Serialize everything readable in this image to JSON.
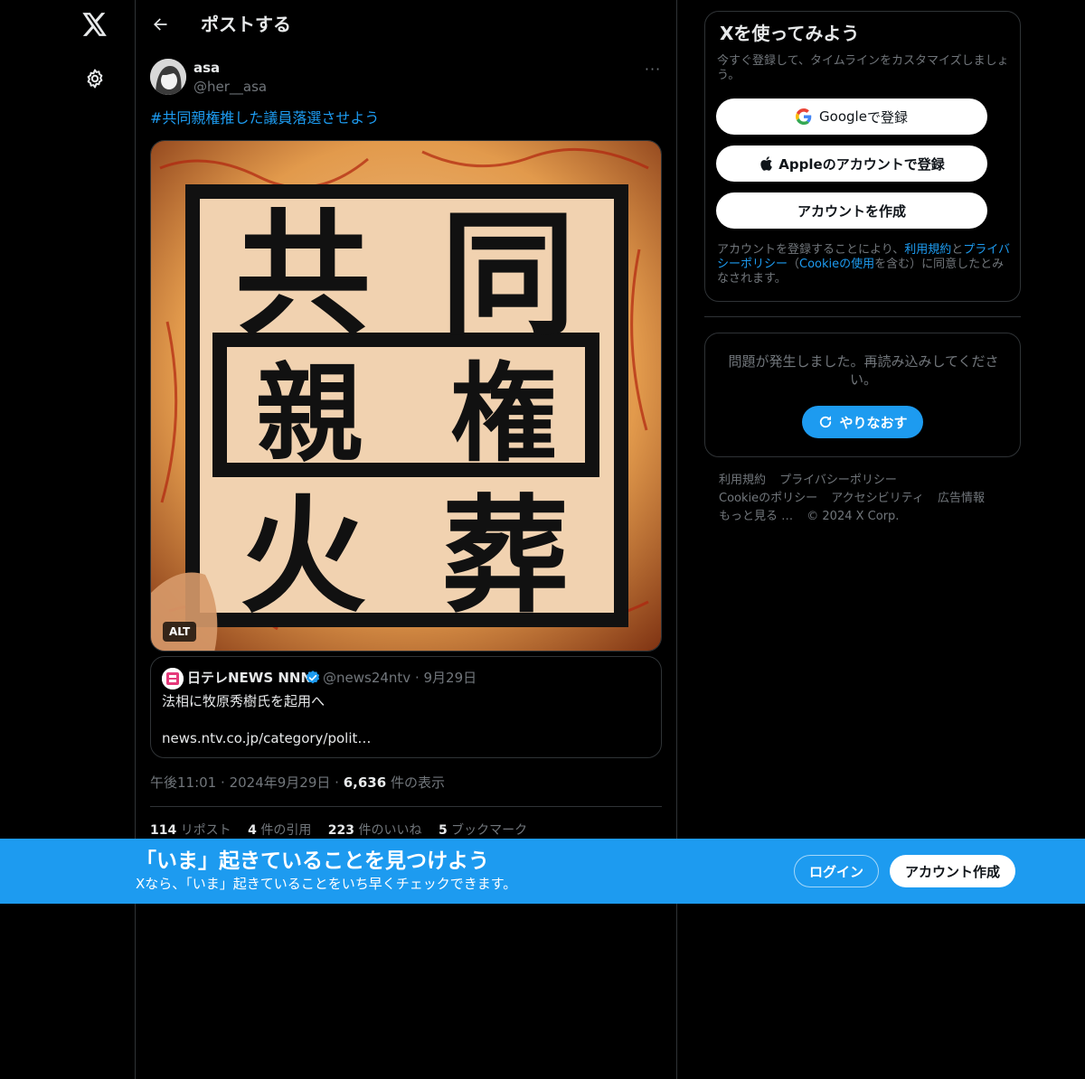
{
  "nav": {
    "title": "ポストする"
  },
  "post": {
    "author_name": "asa",
    "author_handle": "@her__asa",
    "more_label": "···",
    "text": "#共同親権推した議員落選させよう",
    "image_text": [
      "共",
      "同",
      "親",
      "権",
      "火",
      "葬"
    ],
    "alt_label": "ALT",
    "quote": {
      "name": "日テレNEWS NNN",
      "handle": "@news24ntv",
      "date": "9月29日",
      "sep": "·",
      "text": "法相に牧原秀樹氏を起用へ",
      "link": "news.ntv.co.jp/category/polit…"
    },
    "time": "午後11:01",
    "date": "2024年9月29日",
    "sep": "·",
    "views_count": "6,636",
    "views_label": "件の表示",
    "stats": [
      {
        "count": "114",
        "label": "リポスト"
      },
      {
        "count": "4",
        "label": "件の引用"
      },
      {
        "count": "223",
        "label": "件のいいね"
      },
      {
        "count": "5",
        "label": "ブックマーク"
      }
    ]
  },
  "signup": {
    "title": "Xを使ってみよう",
    "subtitle": "今すぐ登録して、タイムラインをカスタマイズしましょう。",
    "google_brand": "Google",
    "google_suffix": " で登録",
    "apple_label": "Appleのアカウントで登録",
    "create_label": "アカウントを作成",
    "terms_1": "アカウントを登録することにより、",
    "terms_link_1": "利用規約",
    "terms_2": "と",
    "terms_link_2": "プライバシーポリシー",
    "terms_3": "（",
    "terms_link_3": "Cookieの使用",
    "terms_4": "を含む）に同意したとみなされます。"
  },
  "error": {
    "text": "問題が発生しました。再読み込みしてください。",
    "retry_label": "やりなおす"
  },
  "footer": {
    "links": [
      "利用規約",
      "プライバシーポリシー",
      "Cookieのポリシー",
      "アクセシビリティ",
      "広告情報",
      "もっと見る …",
      "© 2024 X Corp."
    ]
  },
  "banner": {
    "title": "「いま」起きていることを見つけよう",
    "subtitle": "Xなら、「いま」起きていることをいち早くチェックできます。",
    "login_label": "ログイン",
    "create_label": "アカウント作成"
  },
  "colors": {
    "accent": "#1d9bf0",
    "background": "#000000",
    "border": "#2f3336",
    "muted": "#71767b"
  },
  "icons": [
    "x-logo-icon",
    "gear-icon",
    "back-arrow-icon",
    "more-icon",
    "verified-icon",
    "google-icon",
    "apple-icon",
    "refresh-icon"
  ]
}
